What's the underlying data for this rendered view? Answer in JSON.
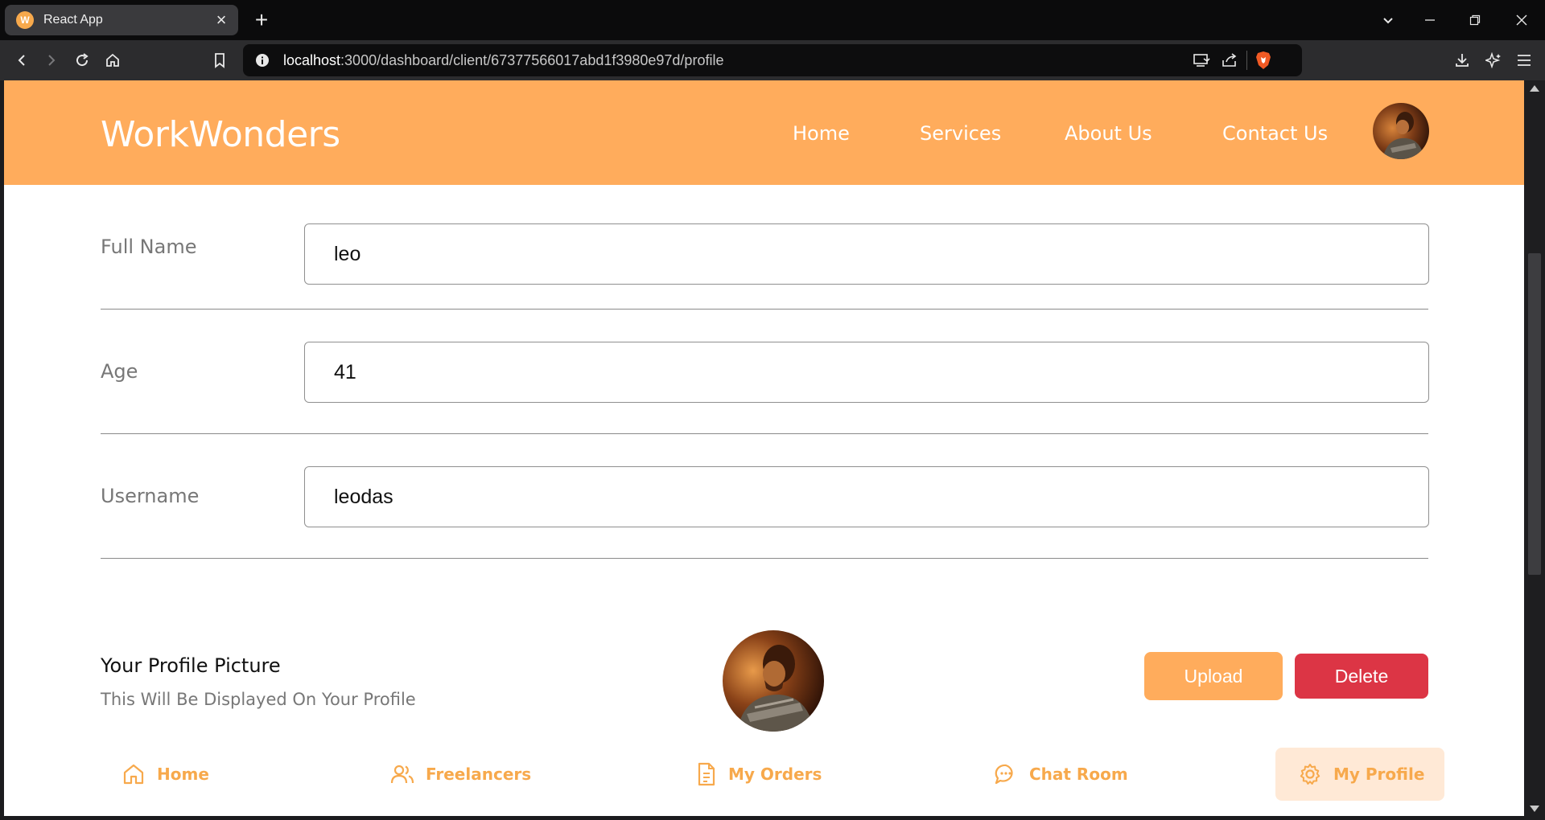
{
  "browser": {
    "tab_title": "React App",
    "favicon_letter": "W",
    "url_host": "localhost",
    "url_rest": ":3000/dashboard/client/67377566017abd1f3980e97d/profile"
  },
  "site": {
    "brand": "WorkWonders",
    "nav": [
      "Home",
      "Services",
      "About Us",
      "Contact Us"
    ]
  },
  "form": {
    "full_name_label": "Full Name",
    "full_name_value": "leo",
    "age_label": "Age",
    "age_value": "41",
    "username_label": "Username",
    "username_value": "leodas"
  },
  "profile_picture": {
    "title": "Your Profile Picture",
    "subtitle": "This Will Be Displayed On Your Profile",
    "upload_label": "Upload",
    "delete_label": "Delete"
  },
  "bottom_nav": {
    "home": "Home",
    "freelancers": "Freelancers",
    "orders": "My Orders",
    "chat": "Chat Room",
    "profile": "My Profile",
    "active": "My Profile"
  },
  "colors": {
    "brand_orange": "#ffac5c",
    "delete_red": "#dc3545",
    "active_bg": "#ffe9d6"
  }
}
